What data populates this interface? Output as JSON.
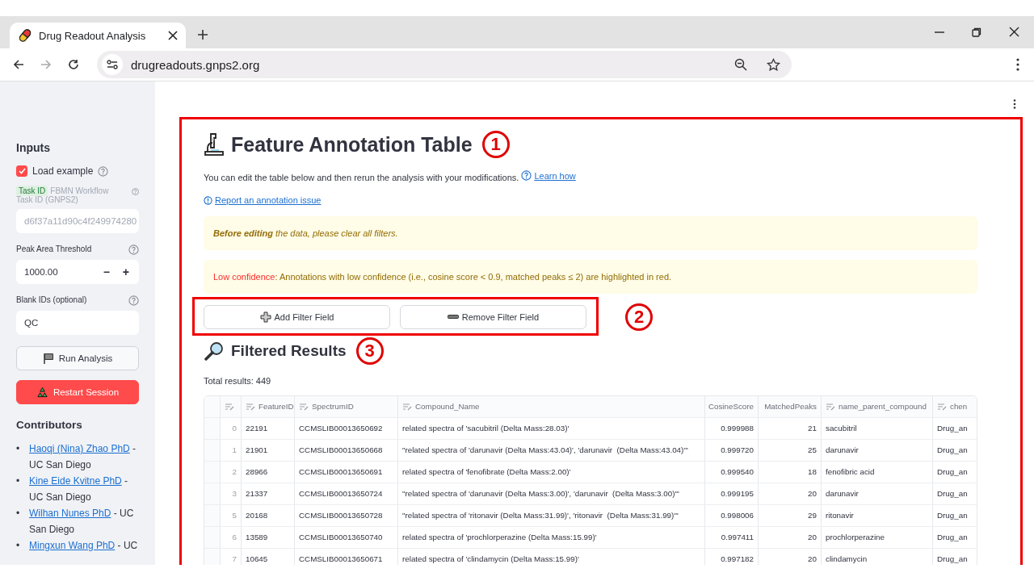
{
  "browser": {
    "tabs": [
      {
        "title": "Drug Readout Analysis",
        "selected": true
      }
    ],
    "url": "drugreadouts.gnps2.org"
  },
  "sidebar": {
    "heading": "Inputs",
    "load_example": {
      "label": "Load example",
      "checked": true
    },
    "task_id": {
      "badge": "Task ID",
      "label": "FBMN Workflow Task ID (GNPS2)",
      "value": "d6f37a11d90c4f249974280",
      "disabled": true
    },
    "threshold": {
      "label": "Peak Area Threshold",
      "value": "1000.00",
      "decrement": "−",
      "increment": "+"
    },
    "blank_ids": {
      "label": "Blank IDs (optional)",
      "value": "QC"
    },
    "buttons": [
      {
        "label": "Run Analysis",
        "kind": "secondary"
      },
      {
        "label": "Restart Session",
        "kind": "primary"
      }
    ],
    "contributors_heading": "Contributors",
    "contributors": [
      {
        "marker": "•",
        "name": "Haoqi (Nina) Zhao PhD",
        "affiliation": "- UC San Diego"
      },
      {
        "marker": "•",
        "name": "Kine Eide Kvitne PhD",
        "affiliation": "- UC San Diego"
      },
      {
        "marker": "•",
        "name": "Wilhan Nunes PhD",
        "affiliation": "- UC San Diego"
      },
      {
        "marker": "•",
        "name": "Mingxun Wang PhD",
        "affiliation": "- UC"
      }
    ]
  },
  "main": {
    "title": "Feature Annotation Table",
    "title_callout": "1",
    "intro": "You can edit the table below and then rerun the analysis with your modifications.",
    "learn_link": "Learn how",
    "report_link": "Report an annotation issue",
    "alerts": [
      {
        "kind": "note",
        "text": "**Before editing** the data, please clear all filters."
      },
      {
        "kind": "highlight",
        "highlight": "Low confidence",
        "text": ": Annotations with low confidence (i.e., cosine score < 0.9, matched peaks ≤ 2) are highlighted in red."
      }
    ],
    "filter_buttons": [
      {
        "label": "Add Filter Field",
        "kind": "add"
      },
      {
        "label": "Remove Filter Field",
        "kind": "remove"
      }
    ],
    "filter_callout": "2",
    "results_title": "Filtered Results",
    "results_callout": "3",
    "total": "Total results: 449",
    "table": {
      "columns": [
        {
          "kind": "index",
          "editable": true
        },
        {
          "label": "FeatureID",
          "kind": "text",
          "editable": true
        },
        {
          "label": "SpectrumID",
          "kind": "text",
          "editable": true
        },
        {
          "label": "Compound_Name",
          "kind": "text",
          "editable": true
        },
        {
          "label": "CosineScore",
          "kind": "number",
          "editable": false
        },
        {
          "label": "MatchedPeaks",
          "kind": "number",
          "editable": false
        },
        {
          "label": "name_parent_compound",
          "kind": "text",
          "editable": true
        },
        {
          "label": "chen",
          "kind": "text",
          "editable": true
        }
      ],
      "rows": [
        [
          "0",
          "22191",
          "CCMSLIB00013650692",
          "related spectra of 'sacubitril (Delta Mass:28.03)'",
          "0.999988",
          "21",
          "sacubitril",
          "Drug_an"
        ],
        [
          "1",
          "21901",
          "CCMSLIB00013650668",
          "\"related spectra of 'darunavir (Delta Mass:43.04)', 'darunavir  (Delta Mass:43.04)'\"",
          "0.999720",
          "25",
          "darunavir",
          "Drug_an"
        ],
        [
          "2",
          "28966",
          "CCMSLIB00013650691",
          "related spectra of 'fenofibrate (Delta Mass:2.00)'",
          "0.999540",
          "18",
          "fenofibric acid",
          "Drug_an"
        ],
        [
          "3",
          "21337",
          "CCMSLIB00013650724",
          "\"related spectra of 'darunavir (Delta Mass:3.00)', 'darunavir  (Delta Mass:3.00)'\"",
          "0.999195",
          "20",
          "darunavir",
          "Drug_an"
        ],
        [
          "5",
          "20168",
          "CCMSLIB00013650728",
          "\"related spectra of 'ritonavir (Delta Mass:31.99)', 'ritonavir  (Delta Mass:31.99)'\"",
          "0.998006",
          "29",
          "ritonavir",
          "Drug_an"
        ],
        [
          "6",
          "13589",
          "CCMSLIB00013650740",
          "related spectra of 'prochlorperazine (Delta Mass:15.99)'",
          "0.997411",
          "20",
          "prochlorperazine",
          "Drug_an"
        ],
        [
          "7",
          "10645",
          "CCMSLIB00013650671",
          "related spectra of 'clindamycin (Delta Mass:15.99)'",
          "0.997182",
          "20",
          "clindamycin",
          "Drug_an"
        ]
      ]
    }
  }
}
